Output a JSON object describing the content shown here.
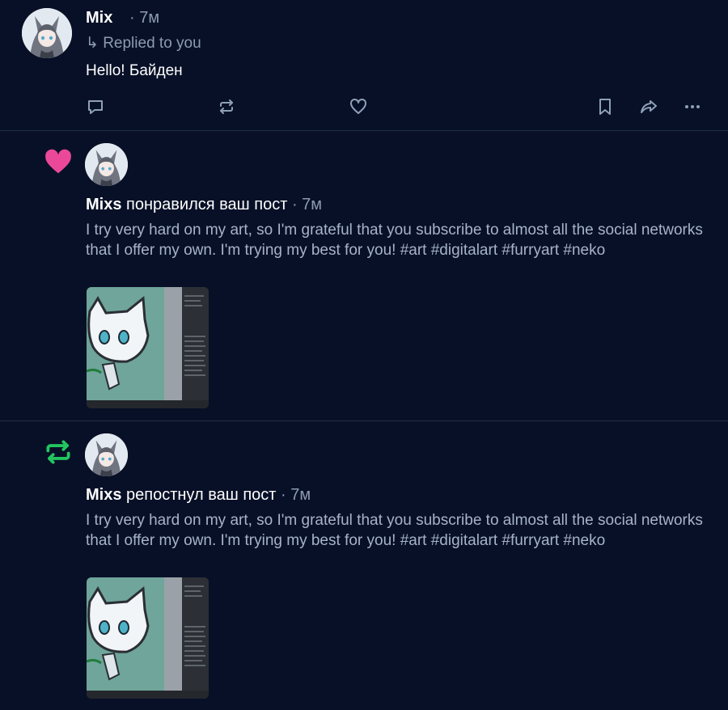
{
  "reply": {
    "author": "Mix",
    "time": "· 7м",
    "replied_label": "↳ Replied to you",
    "text": "Hello! Байден"
  },
  "actions": {
    "icons": [
      "reply-icon",
      "repost-icon",
      "like-icon",
      "bookmark-icon",
      "share-icon",
      "more-icon"
    ]
  },
  "notifications": [
    {
      "kind": "like",
      "kind_icon": "heart-icon",
      "kind_color": "#ec4899",
      "user": "Mixs",
      "action": "понравился ваш пост",
      "time": "· 7м",
      "text": "I try very hard on my art, so I'm grateful that you subscribe to almost all the social networks that I offer my own. I'm trying my best for you! #art #digitalart #furryart #neko"
    },
    {
      "kind": "repost",
      "kind_icon": "repost-icon",
      "kind_color": "#22c55e",
      "user": "Mixs",
      "action": "репостнул ваш пост",
      "time": "· 7м",
      "text": "I try very hard on my art, so I'm grateful that you subscribe to almost all the social networks that I offer my own. I'm trying my best for you! #art #digitalart #furryart #neko"
    }
  ],
  "colors": {
    "background": "#081027",
    "divider": "#1e2f4a",
    "muted_text": "#8c9bb0",
    "body_text": "#a6b3c6",
    "like": "#ec4899",
    "repost": "#22c55e"
  }
}
